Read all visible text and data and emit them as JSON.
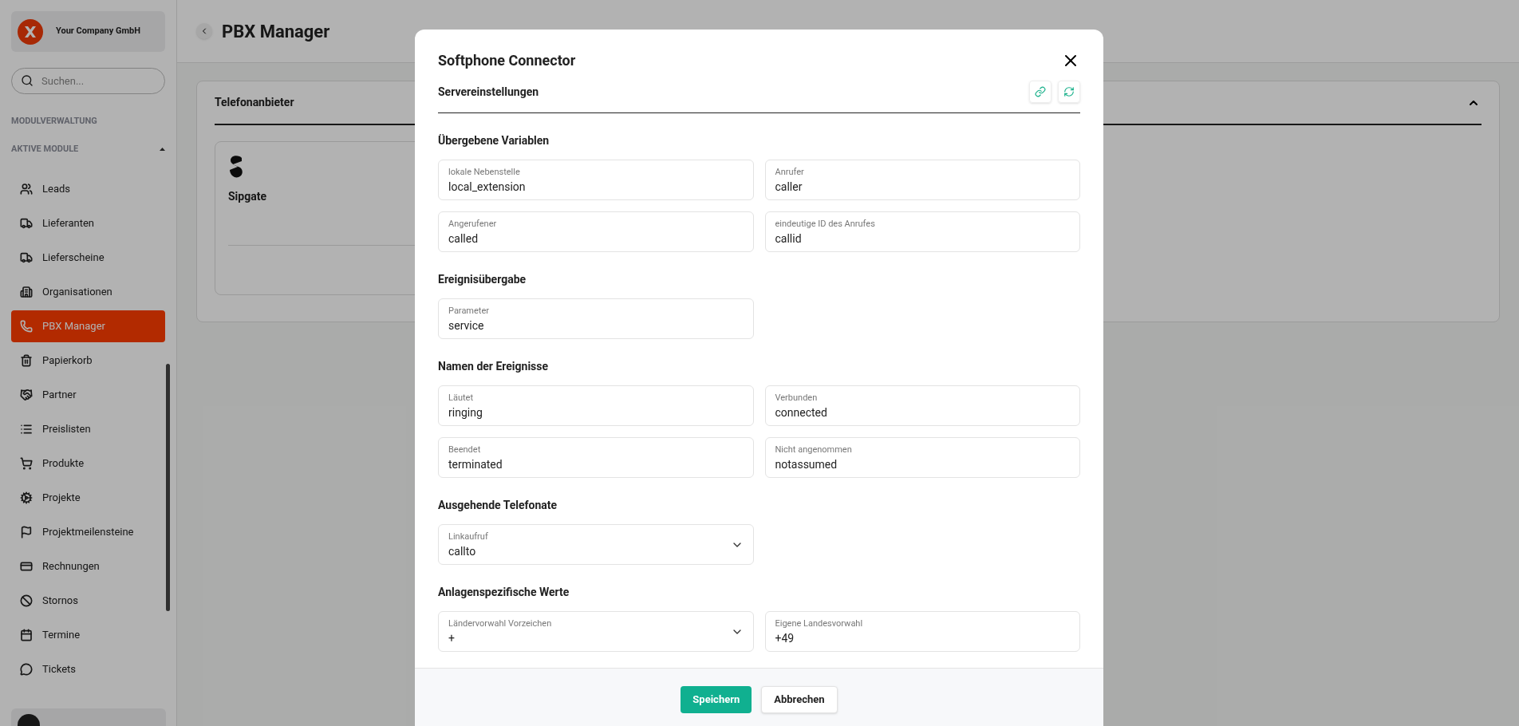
{
  "sidebar": {
    "company": "Your Company GmbH",
    "search": {
      "placeholder": "Suchen..."
    },
    "section_headings": [
      "MODULVERWALTUNG",
      "AKTIVE MODULE"
    ],
    "items": [
      {
        "label": "Leads",
        "selected": false
      },
      {
        "label": "Lieferanten",
        "selected": false
      },
      {
        "label": "Lieferscheine",
        "selected": false
      },
      {
        "label": "Organisationen",
        "selected": false
      },
      {
        "label": "PBX Manager",
        "selected": true
      },
      {
        "label": "Papierkorb",
        "selected": false
      },
      {
        "label": "Partner",
        "selected": false
      },
      {
        "label": "Preislisten",
        "selected": false
      },
      {
        "label": "Produkte",
        "selected": false
      },
      {
        "label": "Projekte",
        "selected": false
      },
      {
        "label": "Projektmeilensteine",
        "selected": false
      },
      {
        "label": "Rechnungen",
        "selected": false
      },
      {
        "label": "Stornos",
        "selected": false
      },
      {
        "label": "Termine",
        "selected": false
      },
      {
        "label": "Tickets",
        "selected": false
      }
    ]
  },
  "page": {
    "title": "PBX Manager",
    "panel": {
      "title": "Telefonanbieter",
      "expanded": true,
      "providers": [
        {
          "name": "Sipgate"
        }
      ]
    }
  },
  "modal": {
    "title": "Softphone Connector",
    "subtitle": "Servereinstellungen",
    "sections": [
      {
        "heading": "Übergebene Variablen",
        "fields": [
          {
            "label": "lokale Nebenstelle",
            "value": "local_extension",
            "kind": "text"
          },
          {
            "label": "Anrufer",
            "value": "caller",
            "kind": "text"
          },
          {
            "label": "Angerufener",
            "value": "called",
            "kind": "text"
          },
          {
            "label": "eindeutige ID des Anrufes",
            "value": "callid",
            "kind": "text"
          }
        ]
      },
      {
        "heading": "Ereignisübergabe",
        "fields": [
          {
            "label": "Parameter",
            "value": "service",
            "kind": "text"
          }
        ]
      },
      {
        "heading": "Namen der Ereignisse",
        "fields": [
          {
            "label": "Läutet",
            "value": "ringing",
            "kind": "text"
          },
          {
            "label": "Verbunden",
            "value": "connected",
            "kind": "text"
          },
          {
            "label": "Beendet",
            "value": "terminated",
            "kind": "text"
          },
          {
            "label": "Nicht angenommen",
            "value": "notassumed",
            "kind": "text"
          }
        ]
      },
      {
        "heading": "Ausgehende Telefonate",
        "fields": [
          {
            "label": "Linkaufruf",
            "value": "callto",
            "kind": "select"
          }
        ]
      },
      {
        "heading": "Anlagenspezifische Werte",
        "fields": [
          {
            "label": "Ländervorwahl Vorzeichen",
            "value": "+",
            "kind": "select"
          },
          {
            "label": "Eigene Landesvorwahl",
            "value": "+49",
            "kind": "text"
          }
        ]
      }
    ],
    "buttons": [
      {
        "label": "Speichern",
        "kind": "primary"
      },
      {
        "label": "Abbrechen",
        "kind": "secondary"
      }
    ]
  }
}
